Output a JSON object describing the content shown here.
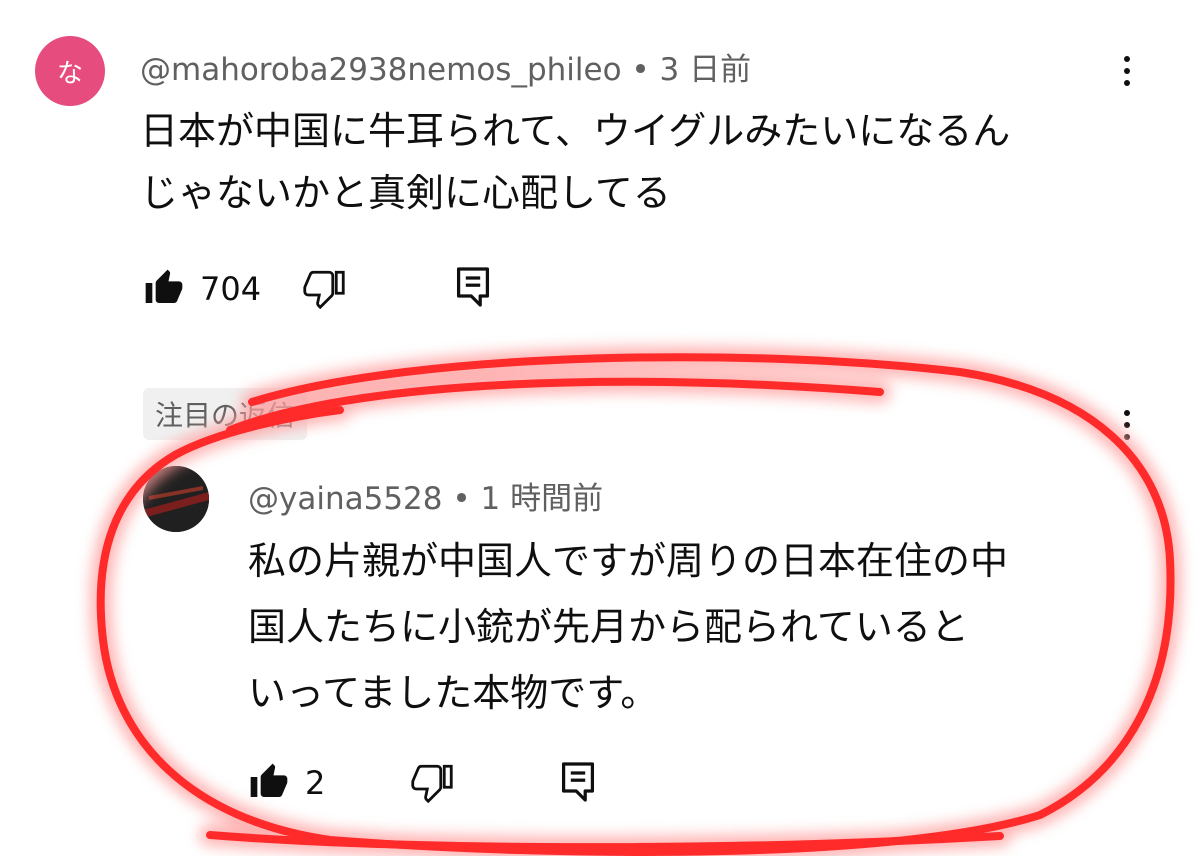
{
  "comment": {
    "avatar_letter": "な",
    "avatar_color": "#e74c7e",
    "author": "@mahoroba2938nemos_phileo",
    "separator": "•",
    "time": "3 日前",
    "text_lines": [
      "日本が中国に牛耳られて、ウイグルみたいになるん",
      "じゃないかと真剣に心配してる"
    ],
    "likes": "704"
  },
  "reply": {
    "badge": "注目の返信",
    "author": "@yaina5528",
    "separator": "•",
    "time": "1 時間前",
    "text_lines": [
      "私の片親が中国人ですが周りの日本在住の中",
      "国人たちに小銃が先月から配られていると",
      "いってました本物です。"
    ],
    "likes": "2"
  },
  "icons": {
    "like": "thumbs-up-icon",
    "dislike": "thumbs-down-icon",
    "reply": "reply-icon",
    "menu": "more-vert-icon"
  },
  "colors": {
    "annotation": "#ff2a2a"
  }
}
